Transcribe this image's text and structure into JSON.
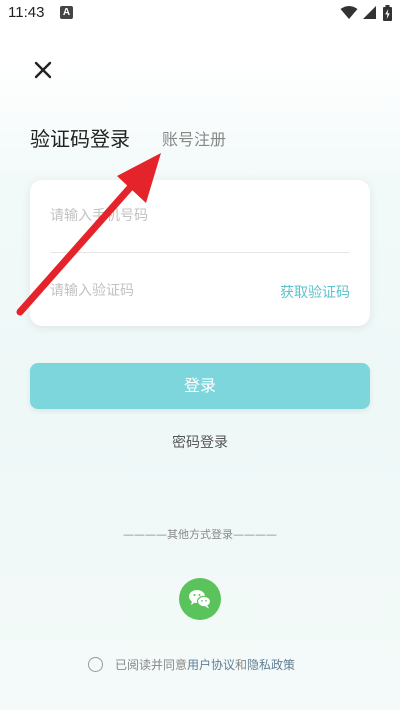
{
  "status_bar": {
    "time": "11:43",
    "notification_icon": "A"
  },
  "header": {
    "close_icon": "close-icon",
    "title": "验证码登录",
    "register_tab": "账号注册"
  },
  "form": {
    "phone_placeholder": "请输入手机号码",
    "code_placeholder": "请输入验证码",
    "get_code_label": "获取验证码"
  },
  "actions": {
    "login_label": "登录",
    "password_login_label": "密码登录"
  },
  "other_login": {
    "divider_text": "————其他方式登录————",
    "wechat_icon": "wechat-icon"
  },
  "agreement": {
    "prefix": "已阅读并同意",
    "user_agreement": "用户协议",
    "and": "和",
    "privacy_policy": "隐私政策"
  },
  "colors": {
    "accent": "#7dd6dc",
    "link": "#5cc3cc",
    "wechat": "#5bc35b",
    "annotation_arrow": "#e5232a"
  }
}
